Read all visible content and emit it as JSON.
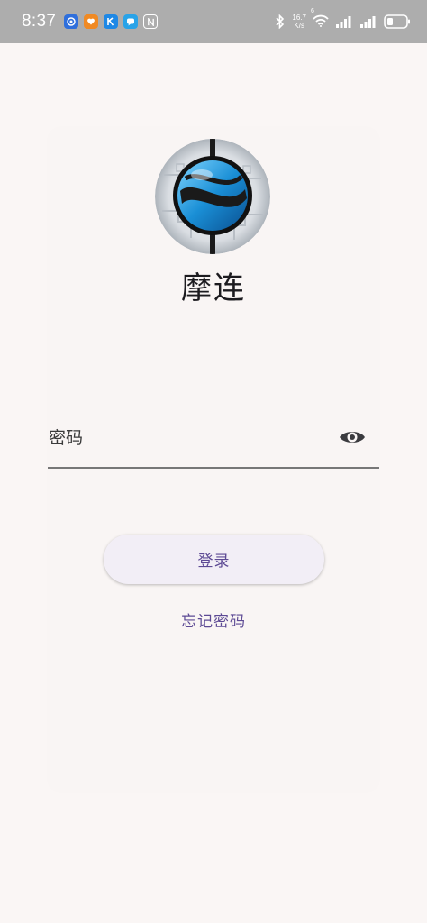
{
  "status_bar": {
    "time": "8:37",
    "net_speed_value": "16.7",
    "net_speed_unit": "K/s",
    "signal_label": "6"
  },
  "app": {
    "name": "摩连"
  },
  "login": {
    "password_label": "密码",
    "login_button": "登录",
    "forgot_password": "忘记密码"
  },
  "colors": {
    "accent": "#5d4a94",
    "status_bar": "#adadad",
    "background": "#faf6f5"
  }
}
